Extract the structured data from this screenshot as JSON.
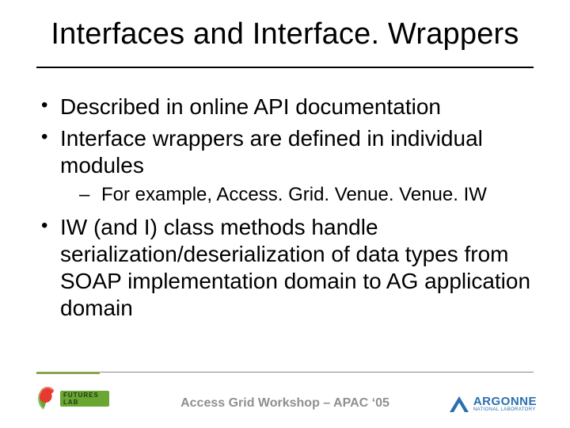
{
  "title": "Interfaces and Interface. Wrappers",
  "bullets": {
    "b1": "Described in online API documentation",
    "b2": "Interface wrappers are defined in individual modules",
    "b2_sub1": "For example, Access. Grid. Venue. Venue. IW",
    "b3": "IW (and I) class methods handle serialization/deserialization of data types from SOAP implementation domain to AG application domain"
  },
  "footer": "Access Grid Workshop – APAC ‘05",
  "logos": {
    "left_label": "FUTURES LAB",
    "right_name": "ARGONNE",
    "right_sub": "NATIONAL LABORATORY"
  }
}
